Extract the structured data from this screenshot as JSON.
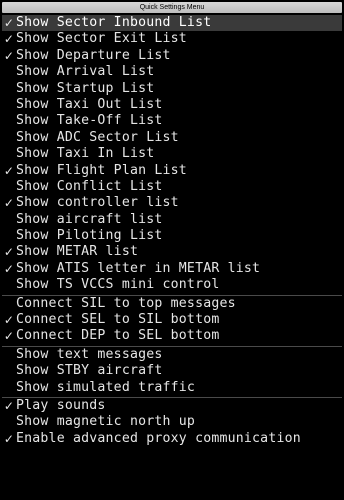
{
  "menu": {
    "title": "Quick Settings Menu",
    "check_glyph": "✓",
    "groups": [
      {
        "items": [
          {
            "label": "Show Sector Inbound List",
            "checked": true,
            "highlight": true
          },
          {
            "label": "Show Sector Exit List",
            "checked": true
          },
          {
            "label": "Show Departure List",
            "checked": true
          },
          {
            "label": "Show Arrival List",
            "checked": false
          },
          {
            "label": "Show Startup List",
            "checked": false
          },
          {
            "label": "Show Taxi Out List",
            "checked": false
          },
          {
            "label": "Show Take-Off List",
            "checked": false
          },
          {
            "label": "Show ADC Sector List",
            "checked": false
          },
          {
            "label": "Show Taxi In List",
            "checked": false
          },
          {
            "label": "Show Flight Plan List",
            "checked": true
          },
          {
            "label": "Show Conflict List",
            "checked": false
          },
          {
            "label": "Show controller list",
            "checked": true
          },
          {
            "label": "Show aircraft list",
            "checked": false
          },
          {
            "label": "Show Piloting List",
            "checked": false
          },
          {
            "label": "Show METAR list",
            "checked": true
          },
          {
            "label": "Show ATIS letter in METAR list",
            "checked": true
          },
          {
            "label": "Show TS VCCS mini control",
            "checked": false
          }
        ]
      },
      {
        "items": [
          {
            "label": "Connect SIL to top messages",
            "checked": false
          },
          {
            "label": "Connect SEL to SIL bottom",
            "checked": true
          },
          {
            "label": "Connect DEP to SEL bottom",
            "checked": true
          }
        ]
      },
      {
        "items": [
          {
            "label": "Show text messages",
            "checked": false
          },
          {
            "label": "Show STBY aircraft",
            "checked": false
          },
          {
            "label": "Show simulated traffic",
            "checked": false
          }
        ]
      },
      {
        "items": [
          {
            "label": "Play sounds",
            "checked": true
          },
          {
            "label": "Show magnetic north up",
            "checked": false
          },
          {
            "label": "Enable advanced proxy communication",
            "checked": true
          }
        ]
      }
    ]
  },
  "colors": {
    "background": "#000000",
    "text": "#e6e6e6",
    "highlight": "#3a3a3a",
    "title_bar": "#c8c8c8",
    "separator": "#4a4a4a"
  }
}
